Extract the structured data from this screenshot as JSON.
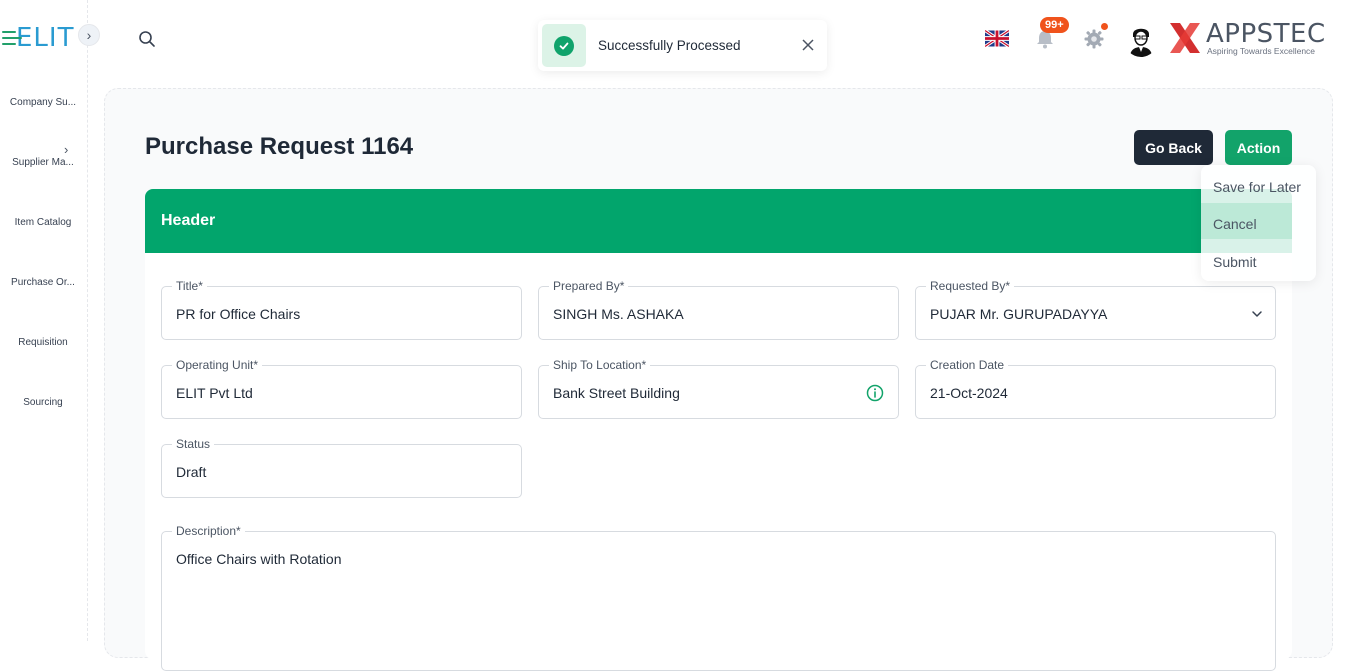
{
  "brand": {
    "app_logo": "ELIT",
    "company_name": "APPSTEC",
    "company_tagline": "Aspiring Towards Excellence",
    "accent_color": "#02a56c"
  },
  "sidebar": {
    "items": [
      {
        "label": "Company Su...",
        "icon": "none"
      },
      {
        "label": "Supplier Ma...",
        "icon": "chevron-right-icon"
      },
      {
        "label": "Item Catalog",
        "icon": "none"
      },
      {
        "label": "Purchase Or...",
        "icon": "none"
      },
      {
        "label": "Requisition",
        "icon": "none"
      },
      {
        "label": "Sourcing",
        "icon": "none"
      }
    ]
  },
  "topbar": {
    "notification_count": "99+",
    "toast": {
      "message": "Successfully Processed",
      "status_color": "#0fa36b"
    }
  },
  "page": {
    "title": "Purchase Request 1164",
    "go_back_label": "Go Back",
    "action_label": "Action",
    "action_menu": [
      "Save for Later",
      "Cancel",
      "Submit"
    ]
  },
  "form": {
    "section_title": "Header",
    "fields": {
      "title": {
        "label": "Title*",
        "value": "PR for Office Chairs"
      },
      "prepared_by": {
        "label": "Prepared By*",
        "value": "SINGH Ms. ASHAKA"
      },
      "requested_by": {
        "label": "Requested By*",
        "value": "PUJAR Mr. GURUPADAYYA"
      },
      "operating_unit": {
        "label": "Operating Unit*",
        "value": "ELIT Pvt Ltd"
      },
      "ship_to_location": {
        "label": "Ship To Location*",
        "value": "Bank Street Building"
      },
      "creation_date": {
        "label": "Creation Date",
        "value": "21-Oct-2024"
      },
      "status": {
        "label": "Status",
        "value": "Draft"
      },
      "description": {
        "label": "Description*",
        "value": "Office Chairs with Rotation"
      }
    }
  }
}
